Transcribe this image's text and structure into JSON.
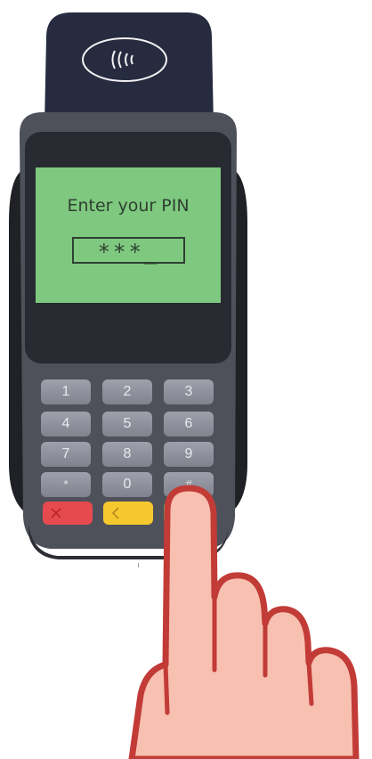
{
  "screen": {
    "prompt": "Enter your PIN",
    "pin_display": "***_"
  },
  "contactless": {
    "icon": "contactless-icon"
  },
  "keypad": {
    "rows": [
      [
        "1",
        "2",
        "3"
      ],
      [
        "4",
        "5",
        "6"
      ],
      [
        "7",
        "8",
        "9"
      ],
      [
        "*",
        "0",
        "#"
      ]
    ],
    "cancel_icon": "x-icon",
    "clear_icon": "chevron-left-icon"
  },
  "colors": {
    "screen_bg": "#7ec97f",
    "terminal_body": "#4a4c55",
    "terminal_top": "#262b3f",
    "key_grey": "#8c8f99",
    "key_cancel": "#e64a4f",
    "key_clear": "#f5c92e",
    "finger_fill": "#f7c0b1",
    "finger_outline": "#c23b36"
  }
}
